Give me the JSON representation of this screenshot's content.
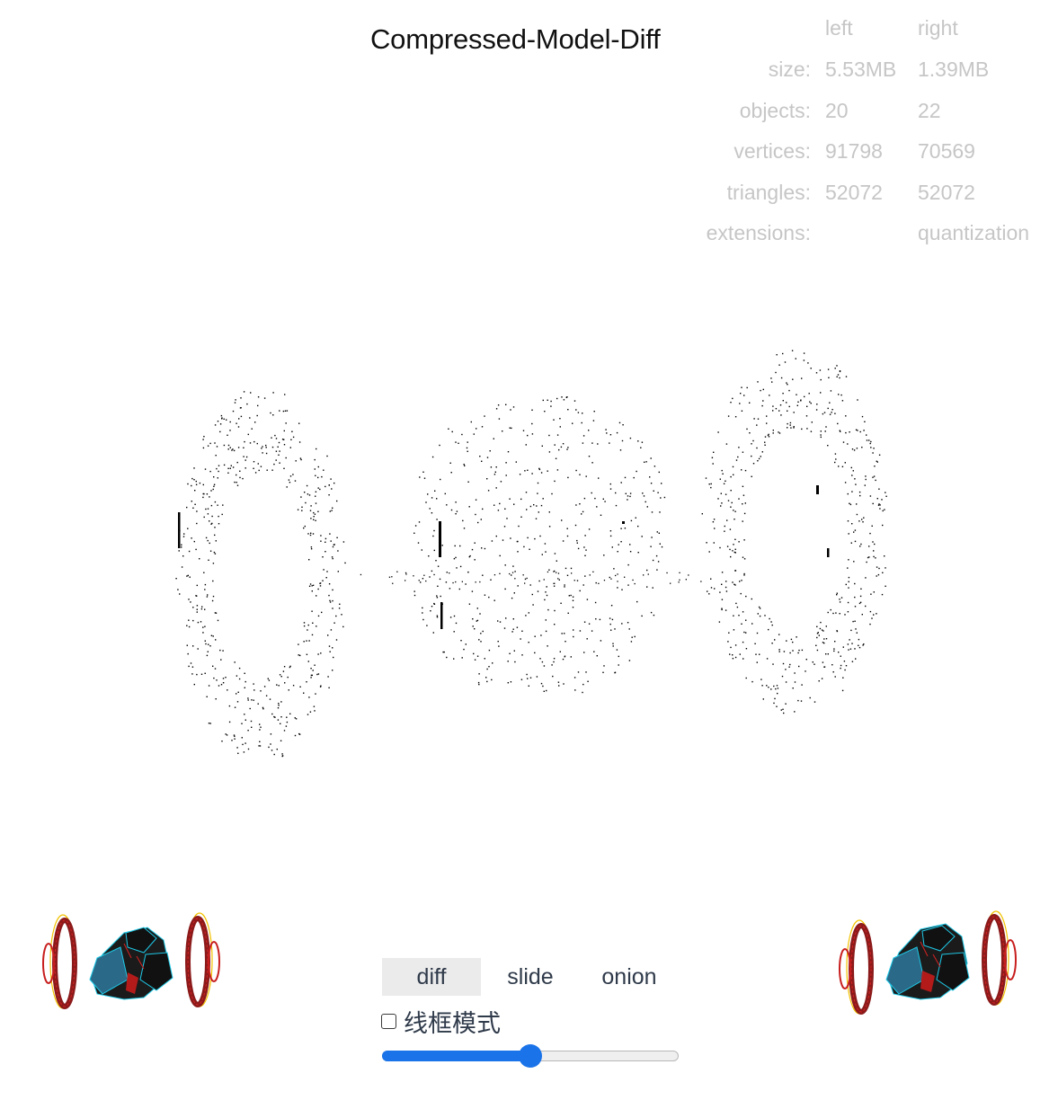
{
  "title": "Compressed-Model-Diff",
  "stats": {
    "header": {
      "left": "left",
      "right": "right"
    },
    "rows": [
      {
        "label": "size:",
        "left": "5.53MB",
        "right": "1.39MB"
      },
      {
        "label": "objects:",
        "left": "20",
        "right": "22"
      },
      {
        "label": "vertices:",
        "left": "91798",
        "right": "70569"
      },
      {
        "label": "triangles:",
        "left": "52072",
        "right": "52072"
      },
      {
        "label": "extensions:",
        "left": "",
        "right": "quantization"
      }
    ]
  },
  "modes": {
    "tabs": [
      "diff",
      "slide",
      "onion"
    ],
    "active": "diff"
  },
  "wireframe": {
    "label": "线框模式",
    "checked": false
  },
  "slider": {
    "value": 0.5
  },
  "colors": {
    "text": "#111111",
    "stat_text": "#c6c6c6",
    "accent": "#1a73e8",
    "active_tab_bg": "#ebebeb",
    "model_body": "#1b1b1b",
    "model_edge_cyan": "#1ec8e6",
    "model_wheel_red": "#d52222",
    "model_wheel_yellow": "#f2c200"
  }
}
